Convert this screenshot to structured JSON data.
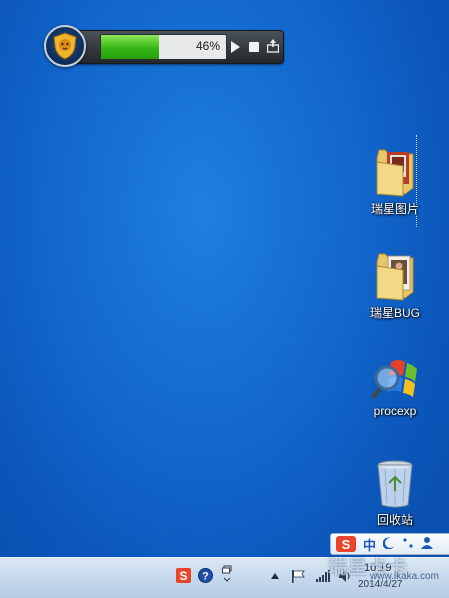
{
  "scan_widget": {
    "progress_label": "46%",
    "progress_value": 0.46,
    "controls": [
      "play-icon",
      "stop-icon",
      "minimize-tray-icon"
    ]
  },
  "desktop_icons": [
    {
      "label": "瑞星图片",
      "icon": "folder-icon"
    },
    {
      "label": "瑞星BUG",
      "icon": "folder-icon"
    },
    {
      "label": "procexp",
      "icon": "procexp-icon"
    },
    {
      "label": "回收站",
      "icon": "recycle-bin-icon"
    }
  ],
  "ime_bar": {
    "logo": "S",
    "mode": "中",
    "symbols": [
      "moon-icon",
      "punctuation-icon",
      "user-icon"
    ]
  },
  "taskbar": {
    "tray_icons": [
      "sogou-tray-icon",
      "help-icon",
      "window-icon",
      "show-hidden-icon",
      "action-center-flag-icon",
      "network-icon",
      "volume-icon"
    ],
    "time": "10:19",
    "date": "2014/4/27"
  },
  "watermark": {
    "text": "瑞星卡卡",
    "url": "www.ikaka.com"
  },
  "colors": {
    "desktop_blue": "#1266cc",
    "progress_green": "#35b614",
    "widget_dark": "#23282d"
  }
}
